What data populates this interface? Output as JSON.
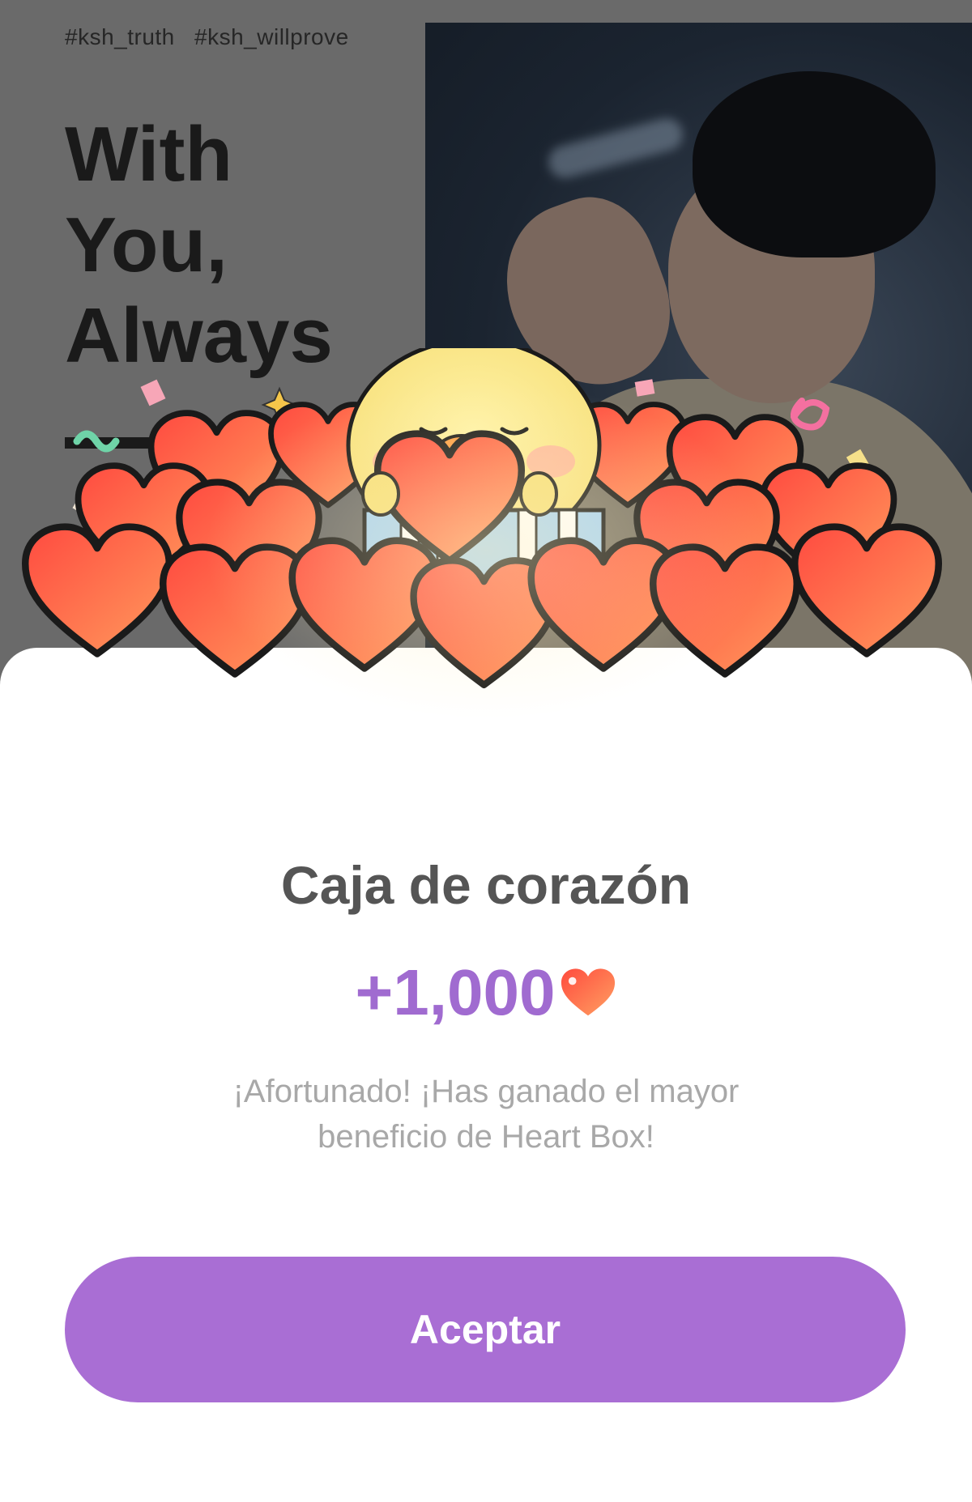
{
  "banner": {
    "hashtags": [
      "#ksh_truth",
      "#ksh_willprove"
    ],
    "headline_lines": [
      "With",
      "You,",
      "Always"
    ]
  },
  "modal": {
    "title": "Caja de corazón",
    "reward_amount": "+1,000",
    "reward_icon": "heart-icon",
    "message_lines": [
      "¡Afortunado! ¡Has ganado el mayor",
      "beneficio de Heart Box!"
    ],
    "accept_label": "Aceptar"
  },
  "colors": {
    "accent": "#a96ed4",
    "reward_text": "#a06bd0",
    "title_text": "#555555",
    "message_text": "#a8a8a8",
    "heart_fill_top": "#ff5a45",
    "heart_fill_bottom": "#ff9560"
  }
}
